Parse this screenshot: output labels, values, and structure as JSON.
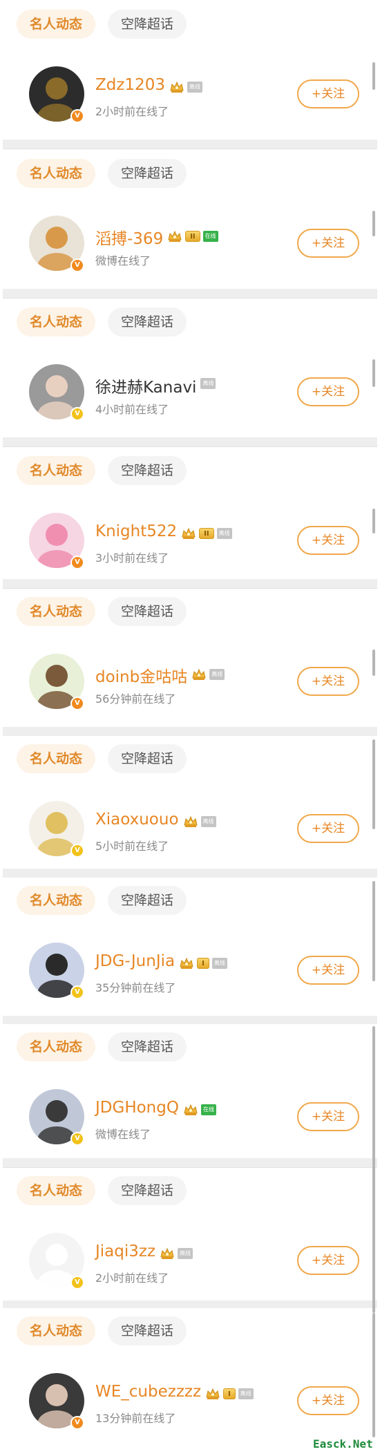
{
  "tabs": {
    "celebrity": "名人动态",
    "super_topic": "空降超话"
  },
  "follow_label": "+关注",
  "watermark": "Easck.Net",
  "colors": {
    "accent": "#e78624",
    "tab_active_bg": "#fdf3e6",
    "verified_orange": "#f08a1e",
    "verified_yellow": "#f3c21a",
    "online_green": "#36b24a"
  },
  "users": [
    {
      "name": "Zdz1203",
      "status": "2小时前在线了",
      "name_color": "orange",
      "crown": true,
      "level": "",
      "tag": "gray",
      "tag_text": "离线",
      "avatar_icon": "dark-helmet-avatar",
      "avatar_bg": "#2c2c2c",
      "avatar_fg": "#8a6b2a",
      "verified": "orange"
    },
    {
      "name": "滔搏-369",
      "status": "微博在线了",
      "name_color": "orange",
      "crown": true,
      "level": "II",
      "tag": "green",
      "tag_text": "在线",
      "avatar_icon": "shiba-dog-avatar",
      "avatar_bg": "#e9e2d6",
      "avatar_fg": "#d89a4a",
      "verified": "orange"
    },
    {
      "name": "徐进赫Kanavi",
      "status": "4小时前在线了",
      "name_color": "gray",
      "crown": false,
      "level": "",
      "tag": "gray",
      "tag_text": "离线",
      "avatar_icon": "player-photo-avatar",
      "avatar_bg": "#9a9a9a",
      "avatar_fg": "#e8d0c0",
      "verified": "yellow"
    },
    {
      "name": "Knight522",
      "status": "3小时前在线了",
      "name_color": "orange",
      "crown": true,
      "level": "II",
      "tag": "gray",
      "tag_text": "离线",
      "avatar_icon": "anime-girl-avatar",
      "avatar_bg": "#f6d6e2",
      "avatar_fg": "#f08fb0",
      "verified": "orange"
    },
    {
      "name": "doinb金咕咕",
      "status": "56分钟前在线了",
      "name_color": "orange",
      "crown": true,
      "level": "",
      "tag": "gray",
      "tag_text": "离线",
      "avatar_icon": "cartoon-bear-avatar",
      "avatar_bg": "#e8f0d8",
      "avatar_fg": "#7a5a3a",
      "verified": "orange"
    },
    {
      "name": "Xiaoxuouo",
      "status": "5小时前在线了",
      "name_color": "orange",
      "crown": true,
      "level": "",
      "tag": "gray",
      "tag_text": "离线",
      "avatar_icon": "anime-character-avatar",
      "avatar_bg": "#f4f0e8",
      "avatar_fg": "#e0c060",
      "verified": "yellow"
    },
    {
      "name": "JDG-JunJia",
      "status": "35分钟前在线了",
      "name_color": "orange",
      "crown": true,
      "level": "I",
      "tag": "gray",
      "tag_text": "离线",
      "avatar_icon": "player-photo-avatar",
      "avatar_bg": "#c9d2e6",
      "avatar_fg": "#2a2a2a",
      "verified": "yellow"
    },
    {
      "name": "JDGHongQ",
      "status": "微博在线了",
      "name_color": "orange",
      "crown": true,
      "level": "",
      "tag": "green",
      "tag_text": "在线",
      "avatar_icon": "player-photo-avatar",
      "avatar_bg": "#c0c8d8",
      "avatar_fg": "#3a3a3a",
      "verified": "yellow"
    },
    {
      "name": "Jiaqi3zz",
      "status": "2小时前在线了",
      "name_color": "orange",
      "crown": true,
      "level": "",
      "tag": "gray",
      "tag_text": "离线",
      "avatar_icon": "white-dog-avatar",
      "avatar_bg": "#f4f4f4",
      "avatar_fg": "#ffffff",
      "verified": "yellow"
    },
    {
      "name": "WE_cubezzzz",
      "status": "13分钟前在线了",
      "name_color": "orange",
      "crown": true,
      "level": "I",
      "tag": "gray",
      "tag_text": "离线",
      "avatar_icon": "player-photo-avatar",
      "avatar_bg": "#3a3a3a",
      "avatar_fg": "#d8c0b0",
      "verified": "orange"
    }
  ]
}
